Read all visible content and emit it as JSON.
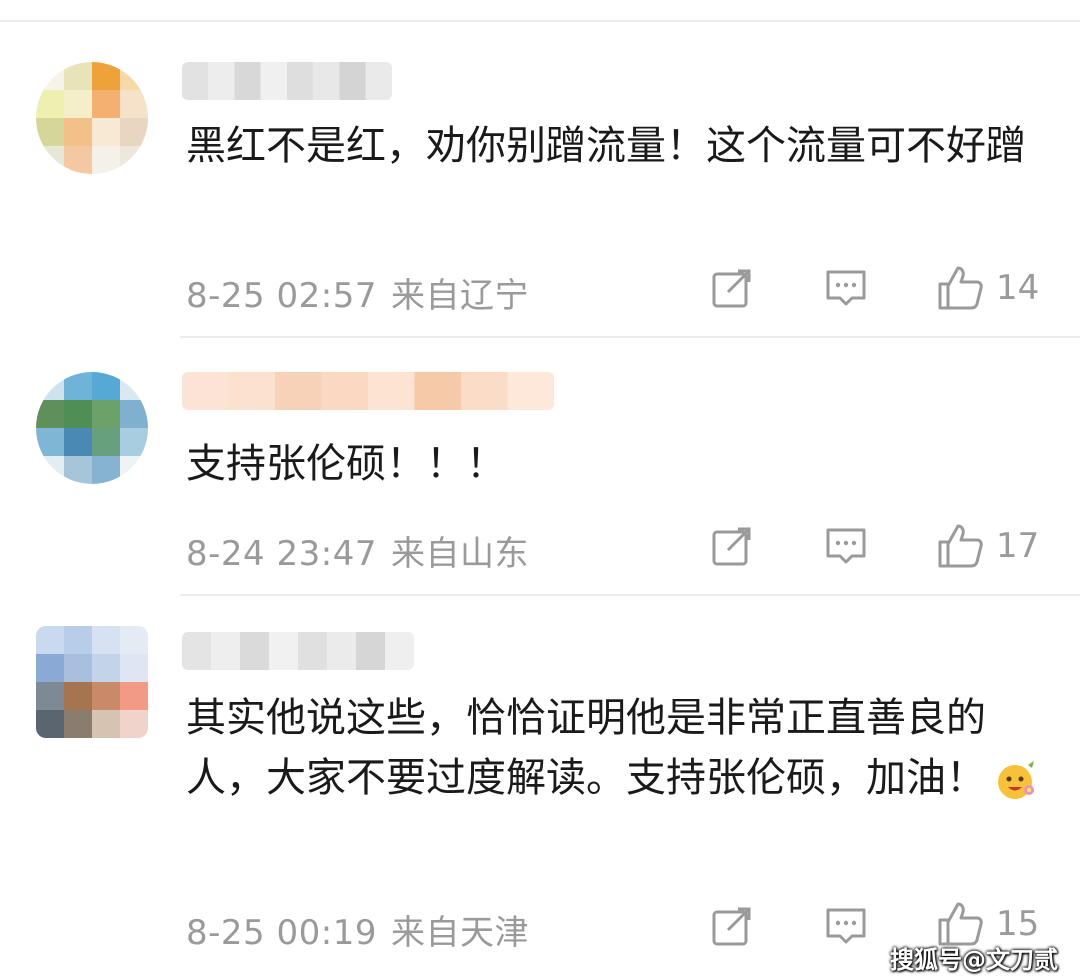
{
  "comments": [
    {
      "text": "黑红不是红，劝你别蹭流量！这个流量可不好蹭",
      "time": "8-25 02:57",
      "location": "来自辽宁",
      "likes": "14",
      "avatar_colors": [
        "#f6f3ea",
        "#e9e3b9",
        "#f0a23a",
        "#f7d9a8",
        "#eef0b0",
        "#f5efc9",
        "#f3b070",
        "#f5e2c8",
        "#d5d79a",
        "#f3c08a",
        "#f7e9d4",
        "#e9d6c1",
        "#e8e6d4",
        "#f3c8a3",
        "#f5f1e8",
        "#eee7db"
      ],
      "username_colors": [
        "#e2e2e2",
        "#ededed",
        "#d8d8d8",
        "#f0f0f0",
        "#dedede",
        "#e8e8e8",
        "#d4d4d4",
        "#eaeaea"
      ]
    },
    {
      "text": "支持张伦硕！！！",
      "time": "8-24 23:47",
      "location": "来自山东",
      "likes": "17",
      "avatar_colors": [
        "#cfe3ee",
        "#6fb4d8",
        "#56a8d5",
        "#d9e9f0",
        "#5f8f5a",
        "#4f8e54",
        "#6da16a",
        "#7fb0d0",
        "#7fb6d6",
        "#4b89b5",
        "#66a07c",
        "#a8cde0",
        "#e3eef2",
        "#a7c5d8",
        "#86b3cf",
        "#eef4f6"
      ],
      "username_colors": [
        "#fbe3d6",
        "#fde1cf",
        "#f7d2b8",
        "#fbd8c2",
        "#fde3d1",
        "#f6c9a8",
        "#fbdcc7",
        "#fde8d9"
      ]
    },
    {
      "text": "其实他说这些，恰恰证明他是非常正直善良的人，大家不要过度解读。支持张伦硕，加油！",
      "time": "8-25 00:19",
      "location": "来自天津",
      "likes": "15",
      "avatar_colors": [
        "#c9d9ee",
        "#b7cde9",
        "#d6e2f2",
        "#e3ebf5",
        "#8aa9d4",
        "#a9bfde",
        "#c3d3ea",
        "#dde6f2",
        "#7d8a95",
        "#a6744f",
        "#c98a6a",
        "#f39a86",
        "#5a6570",
        "#8a7d6f",
        "#d7c3b1",
        "#f0d3cb"
      ],
      "username_colors": [
        "#e4e4e4",
        "#eeeeee",
        "#dadada",
        "#f1f1f1",
        "#e0e0e0",
        "#ebebeb",
        "#d6d6d6",
        "#efefef"
      ]
    }
  ],
  "icons": {
    "share": "share-icon",
    "comment": "comment-icon",
    "like": "thumbs-up-icon",
    "emoji": "flower-face-emoji"
  },
  "watermark": "搜狐号@文刀贰"
}
